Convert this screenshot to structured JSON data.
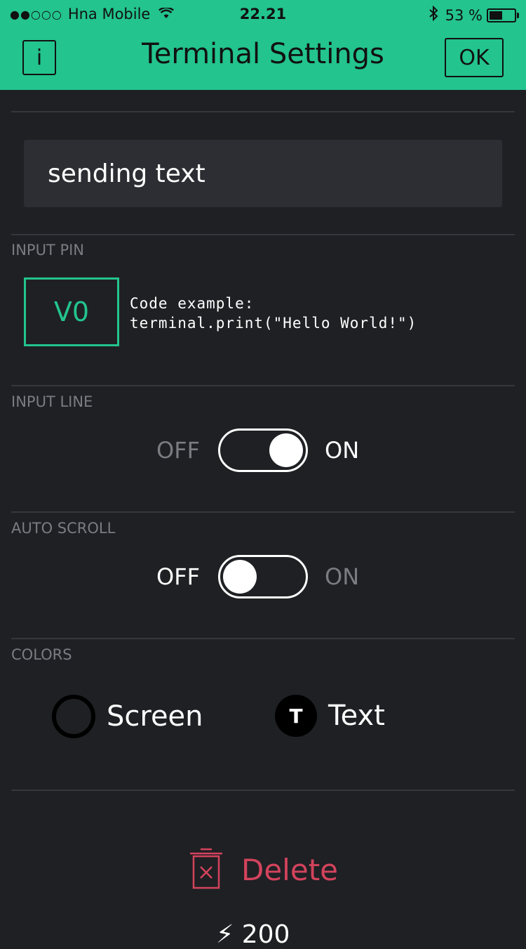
{
  "status_bar": {
    "carrier": "Hna Mobile",
    "time": "22.21",
    "battery": "53 %",
    "battery_level": 0.53
  },
  "header": {
    "info_label": "i",
    "title": "Terminal Settings",
    "ok_label": "OK",
    "background": "#23c48e"
  },
  "text_field": {
    "value": "sending text"
  },
  "input_pin": {
    "section_label": "INPUT PIN",
    "pin": "V0",
    "code_line1": "Code example:",
    "code_line2": "terminal.print(\"Hello World!\")"
  },
  "input_line": {
    "section_label": "INPUT LINE",
    "off_label": "OFF",
    "on_label": "ON",
    "state": "on"
  },
  "auto_scroll": {
    "section_label": "AUTO SCROLL",
    "off_label": "OFF",
    "on_label": "ON",
    "state": "off"
  },
  "colors": {
    "section_label": "COLORS",
    "screen_label": "Screen",
    "text_label": "Text",
    "text_icon_letter": "T"
  },
  "delete": {
    "label": "Delete",
    "color": "#d3435c"
  },
  "cost": {
    "value": "200"
  }
}
